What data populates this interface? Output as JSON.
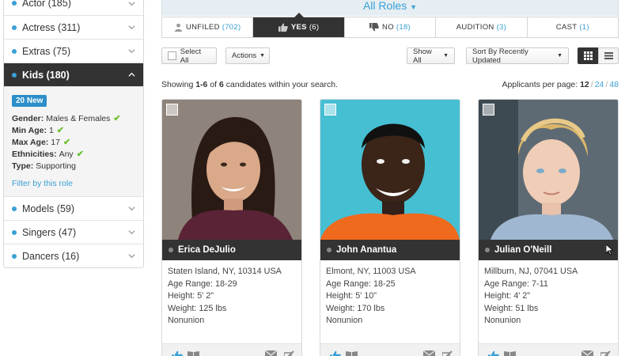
{
  "sidebar": {
    "roles": [
      {
        "name": "Actor",
        "count": "(185)"
      },
      {
        "name": "Actress",
        "count": "(311)"
      },
      {
        "name": "Extras",
        "count": "(75)"
      },
      {
        "name": "Kids",
        "count": "(180)"
      },
      {
        "name": "Models",
        "count": "(59)"
      },
      {
        "name": "Singers",
        "count": "(47)"
      },
      {
        "name": "Dancers",
        "count": "(16)"
      }
    ],
    "kids_detail": {
      "badge": "20 New",
      "gender_label": "Gender:",
      "gender_value": "Males & Females",
      "min_age_label": "Min Age:",
      "min_age_value": "1",
      "max_age_label": "Max Age:",
      "max_age_value": "17",
      "ethnicities_label": "Ethnicities:",
      "ethnicities_value": "Any",
      "type_label": "Type:",
      "type_value": "Supporting",
      "filter_link": "Filter by this role"
    }
  },
  "header": {
    "title": "All Roles",
    "tabs": [
      {
        "label": "UNFILED",
        "count": "(702)",
        "icon": "user-icon"
      },
      {
        "label": "YES",
        "count": "(6)",
        "icon": "thumbs-up-icon"
      },
      {
        "label": "NO",
        "count": "(18)",
        "icon": "thumbs-down-icon"
      },
      {
        "label": "AUDITION",
        "count": "(3)",
        "icon": ""
      },
      {
        "label": "CAST",
        "count": "(1)",
        "icon": ""
      }
    ]
  },
  "toolbar": {
    "select_all": "Select All",
    "actions": "Actions",
    "show_all": "Show All",
    "sort": "Sort By Recently Updated"
  },
  "summary": {
    "prefix": "Showing",
    "range": "1-6",
    "of": "of",
    "total": "6",
    "suffix": "candidates within your search."
  },
  "per_page": {
    "label": "Applicants per page:",
    "options": [
      "12",
      "24",
      "48"
    ],
    "selected": "12"
  },
  "candidates": [
    {
      "name": "Erica DeJulio",
      "location": "Staten Island, NY, 10314 USA",
      "age_range": "Age Range: 18-29",
      "height": "Height: 5' 2\"",
      "weight": "Weight: 125 lbs",
      "union": "Nonunion"
    },
    {
      "name": "John Anantua",
      "location": "Elmont, NY, 11003 USA",
      "age_range": "Age Range: 18-25",
      "height": "Height: 5' 10\"",
      "weight": "Weight: 170 lbs",
      "union": "Nonunion"
    },
    {
      "name": "Julian O'Neill",
      "location": "Millburn, NJ, 07041 USA",
      "age_range": "Age Range: 7-11",
      "height": "Height: 4' 2\"",
      "weight": "Weight: 51 lbs",
      "union": "Nonunion"
    }
  ],
  "colors": {
    "accent": "#3aa0d5",
    "dark": "#333333",
    "check": "#6cbf2c"
  }
}
